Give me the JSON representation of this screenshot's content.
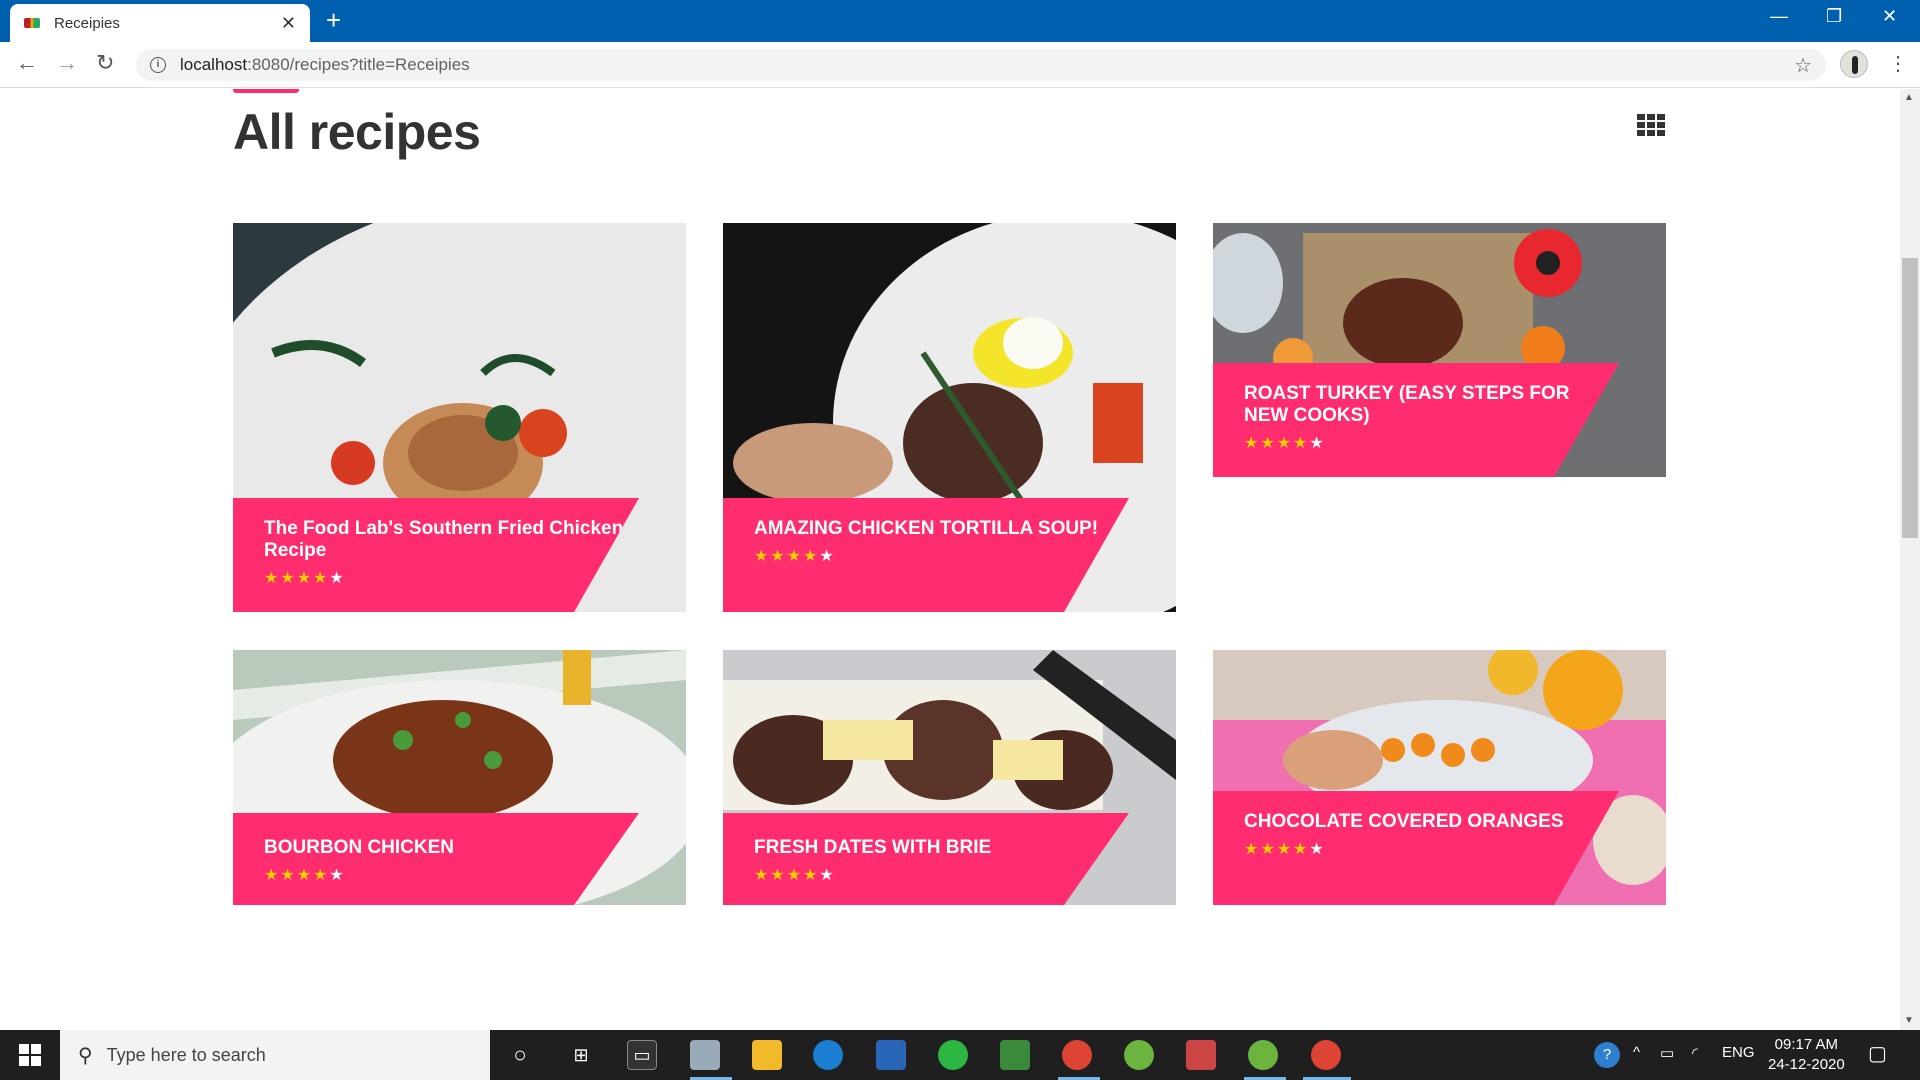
{
  "browser": {
    "tab_title": "Receipies",
    "url_host": "localhost",
    "url_path": ":8080/recipes?title=Receipies"
  },
  "page": {
    "heading": "All recipes"
  },
  "recipes": [
    {
      "name": "The Food Lab's Southern Fried Chicken Recipe",
      "rating": 4,
      "max_rating": 5
    },
    {
      "name": "AMAZING CHICKEN TORTILLA SOUP!",
      "rating": 4,
      "max_rating": 5
    },
    {
      "name": "ROAST TURKEY (EASY STEPS FOR NEW COOKS)",
      "rating": 4,
      "max_rating": 5
    },
    {
      "name": "BOURBON CHICKEN",
      "rating": 4,
      "max_rating": 5
    },
    {
      "name": "FRESH DATES WITH BRIE",
      "rating": 4,
      "max_rating": 5
    },
    {
      "name": "CHOCOLATE COVERED ORANGES",
      "rating": 4,
      "max_rating": 5
    }
  ],
  "taskbar": {
    "search_placeholder": "Type here to search",
    "language": "ENG",
    "time": "09:17 AM",
    "date": "24-12-2020"
  },
  "colors": {
    "accent": "#ff2d6f",
    "star": "#ffcc00",
    "titlebar": "#0060b0"
  }
}
